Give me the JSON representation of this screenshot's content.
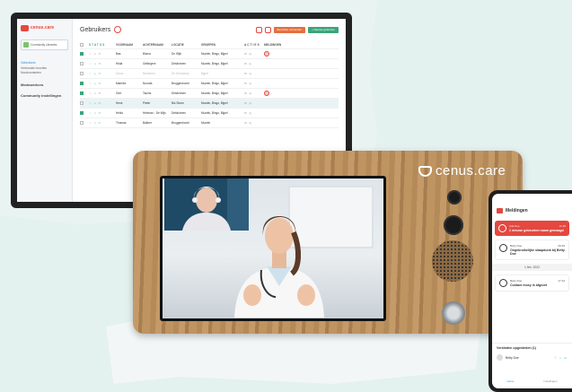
{
  "tablet": {
    "logo": "cenus.care",
    "library_select": "Community Libraries",
    "sidebar_links": [
      "Gebruikers",
      "Verbonden functies",
      "Noodcontacten"
    ],
    "section_medewerkers": "Medewerkers",
    "section_instellingen": "Community instellingen",
    "title": "Gebruikers",
    "btn_verwijderen": "Berichten verzenden",
    "btn_nieuw": "+ Nieuwe gebruiker",
    "columns": [
      "STATUS",
      "VOORNAAM",
      "ACHTERNAAM",
      "LOCATIE",
      "GROEPEN",
      "ACTIES",
      "MELDINGEN"
    ],
    "rows": [
      {
        "first": "Bas",
        "last": "Bisma",
        "loc": "De Wijk",
        "grp": "Muziek, Bingo, Bijpel",
        "checked": true,
        "alert": true,
        "style": ""
      },
      {
        "first": "Hilda",
        "last": "Gellingem",
        "loc": "Detzkinnen",
        "grp": "Muziek, Bingo, Bijpel",
        "checked": false,
        "alert": false,
        "style": ""
      },
      {
        "first": "Dorus",
        "last": "Nnmenen",
        "loc": "De Dorskamp",
        "grp": "Bijpel",
        "checked": false,
        "alert": false,
        "style": "faded"
      },
      {
        "first": "Marieke",
        "last": "Noorda",
        "loc": "Bruggenborch",
        "grp": "Muziek, Bingo, Bijpel",
        "checked": true,
        "alert": false,
        "style": ""
      },
      {
        "first": "Gert",
        "last": "Taunts",
        "loc": "Detzkinnen",
        "grp": "Muziek, Bingo, Bijpel",
        "checked": true,
        "alert": true,
        "style": ""
      },
      {
        "first": "Henk",
        "last": "Pieter",
        "loc": "Bis Storm",
        "grp": "Muziek, Bingo, Bijpel",
        "checked": false,
        "alert": false,
        "style": "hl"
      },
      {
        "first": "Heiko",
        "last": "Hekman - De Wijs",
        "loc": "Detzkinnen",
        "grp": "Muziek, Bingo, Bijpel",
        "checked": true,
        "alert": false,
        "style": ""
      },
      {
        "first": "Thomas",
        "last": "Bakker",
        "loc": "Bruggenborch",
        "grp": "Muziek",
        "checked": false,
        "alert": false,
        "style": ""
      }
    ]
  },
  "device": {
    "brand": "cenus.care"
  },
  "phone": {
    "title": "Meldingen",
    "alerts": [
      {
        "who": "Ada Doe",
        "time": "11:28",
        "msg": "1 nieuwe gebeurten naam gemaagd",
        "style": "red"
      },
      {
        "who": "Betty Doe",
        "time": "09:30",
        "msg": "Ongebruikelijke slaapdunk bij Betty Doe",
        "style": "white"
      }
    ],
    "date_sep": "1 feb. 2022",
    "alerts2": [
      {
        "who": "Betty Doe",
        "time": "17:12",
        "msg": "Contact mosy is afgezet",
        "style": "white"
      }
    ],
    "approve_title": "Verbinden opgesteden (1)",
    "approve_user": "Betty Doe",
    "nav": [
      "Home",
      "Instellingen"
    ]
  }
}
